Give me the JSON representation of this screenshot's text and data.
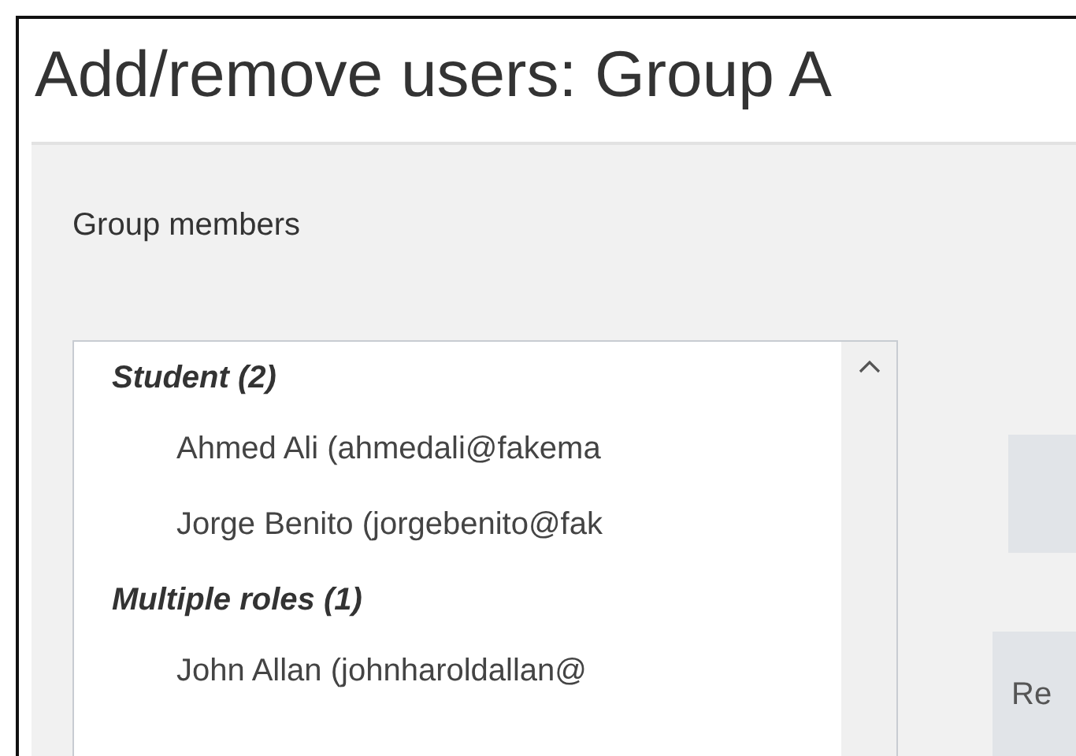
{
  "page_title": "Add/remove users: Group A",
  "members_panel": {
    "label": "Group members",
    "groups": [
      {
        "role": "Student (2)",
        "members": [
          "Ahmed Ali (ahmedali@fakema",
          "Jorge Benito (jorgebenito@fak"
        ]
      },
      {
        "role": "Multiple roles (1)",
        "members": [
          "John Allan (johnharoldallan@"
        ]
      }
    ]
  },
  "side_button": {
    "label": "Re"
  }
}
